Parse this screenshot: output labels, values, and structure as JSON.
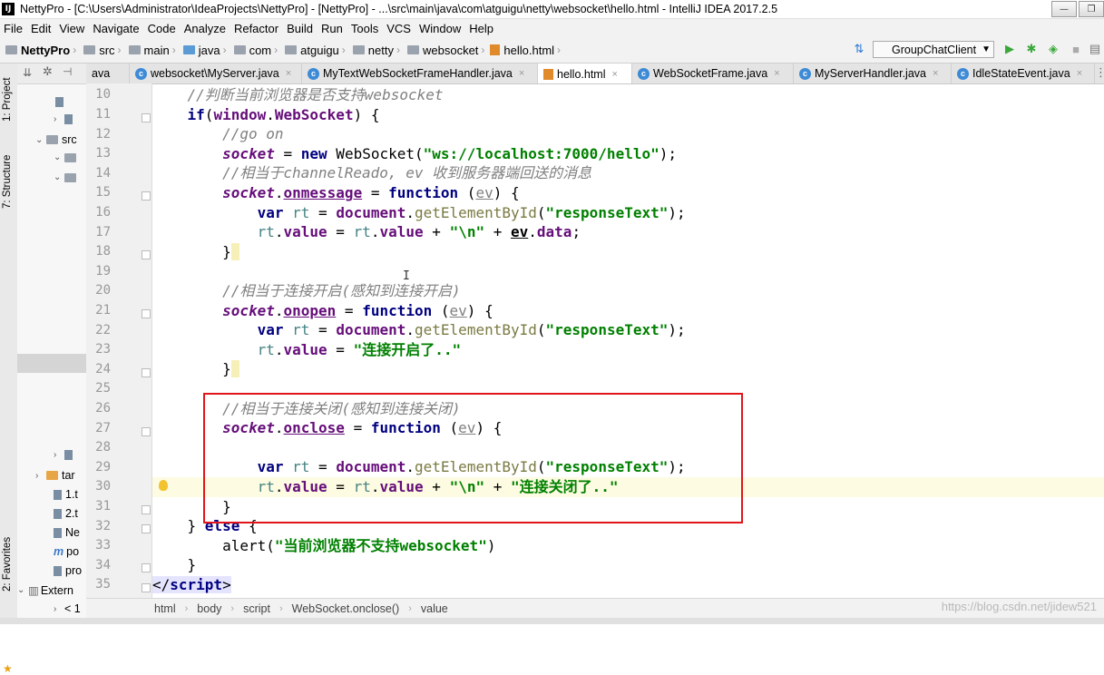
{
  "titlebar": {
    "title": "NettyPro - [C:\\Users\\Administrator\\IdeaProjects\\NettyPro] - [NettyPro] - ...\\src\\main\\java\\com\\atguigu\\netty\\websocket\\hello.html - IntelliJ IDEA 2017.2.5"
  },
  "menu": [
    "File",
    "Edit",
    "View",
    "Navigate",
    "Code",
    "Analyze",
    "Refactor",
    "Build",
    "Run",
    "Tools",
    "VCS",
    "Window",
    "Help"
  ],
  "breadcrumbs": [
    "NettyPro",
    "src",
    "main",
    "java",
    "com",
    "atguigu",
    "netty",
    "websocket",
    "hello.html"
  ],
  "run_config": "GroupChatClient",
  "side_labels": {
    "project": "1: Project",
    "structure": "7: Structure",
    "favorites": "2: Favorites"
  },
  "project_tree": [
    "src",
    "tar",
    "1.t",
    "2.t",
    "Ne",
    "po",
    "pro",
    "Extern",
    "< 1"
  ],
  "tabs": [
    {
      "label": "ava",
      "icon": "none"
    },
    {
      "label": "websocket\\MyServer.java",
      "icon": "class-icon"
    },
    {
      "label": "MyTextWebSocketFrameHandler.java",
      "icon": "class-icon"
    },
    {
      "label": "hello.html",
      "icon": "html-icon",
      "active": true
    },
    {
      "label": "WebSocketFrame.java",
      "icon": "class-icon"
    },
    {
      "label": "MyServerHandler.java",
      "icon": "class-icon"
    },
    {
      "label": "IdleStateEvent.java",
      "icon": "class-icon"
    }
  ],
  "line_numbers": [
    "10",
    "11",
    "12",
    "13",
    "14",
    "15",
    "16",
    "17",
    "18",
    "19",
    "20",
    "21",
    "22",
    "23",
    "24",
    "25",
    "26",
    "27",
    "28",
    "29",
    "30",
    "31",
    "32",
    "33",
    "34",
    "35"
  ],
  "code": {
    "c10": "//判断当前浏览器是否支持websocket",
    "c12": "//go on",
    "ws_url": "\"ws://localhost:7000/hello\"",
    "c14": "//相当于channelReado, ev 收到服务器端回送的消息",
    "resp_id": "\"responseText\"",
    "newline": "\"\\n\"",
    "c20": "//相当于连接开启(感知到连接开启)",
    "opened": "\"连接开启了..\"",
    "c26": "//相当于连接关闭(感知到连接关闭)",
    "closed": "\"连接关闭了..\"",
    "unsupported": "\"当前浏览器不支持websocket\""
  },
  "status_path": [
    "html",
    "body",
    "script",
    "WebSocket.onclose()",
    "value"
  ],
  "watermark": "https://blog.csdn.net/jidew521"
}
